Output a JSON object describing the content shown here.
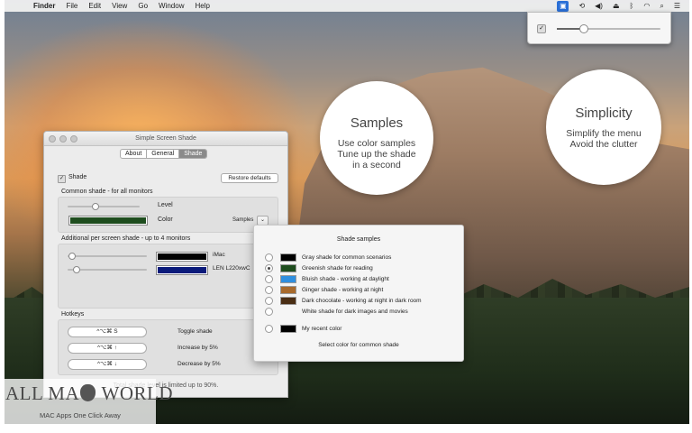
{
  "menubar": {
    "apple": "",
    "items": [
      "Finder",
      "File",
      "Edit",
      "View",
      "Go",
      "Window",
      "Help"
    ],
    "status_icons": [
      "shade-app-icon",
      "time-machine-icon",
      "volume-icon",
      "eject-icon",
      "bluetooth-icon",
      "wifi-icon",
      "spotlight-icon",
      "notification-list-icon"
    ]
  },
  "menu_panel": {
    "checkbox_checked": "✓",
    "level": 0.25
  },
  "bubbles": {
    "samples": {
      "title": "Samples",
      "line1": "Use color samples",
      "line2": "Tune up the shade",
      "line3": "in a second"
    },
    "simplicity": {
      "title": "Simplicity",
      "line1": "Simplify the menu",
      "line2": "Avoid the clutter"
    }
  },
  "window": {
    "title": "Simple Screen Shade",
    "tabs": [
      "About",
      "General",
      "Shade"
    ],
    "active_tab": "Shade",
    "shade_label": "Shade",
    "restore_button": "Restore defaults",
    "common_header": "Common shade - for all monitors",
    "level_label": "Level",
    "color_label": "Color",
    "samples_label": "Samples",
    "common_level": 0.38,
    "common_color": "#1e4d1e",
    "additional_header": "Additional per screen shade - up to 4 monitors",
    "monitors": [
      {
        "name": "iMac",
        "color": "#000000",
        "level": 0.04
      },
      {
        "name": "LEN L220xwC",
        "color": "#0a1a7a",
        "level": 0.1
      }
    ],
    "hotkeys_header": "Hotkeys",
    "hotkeys": [
      {
        "keys": "^⌥⌘ S",
        "action": "Toggle shade"
      },
      {
        "keys": "^⌥⌘ ↑",
        "action": "Increase by 5%"
      },
      {
        "keys": "^⌥⌘ ↓",
        "action": "Decrease by 5%"
      }
    ],
    "total_note": "Total shade level is limited up to 90%."
  },
  "samples_popup": {
    "title": "Shade samples",
    "items": [
      {
        "label": "Gray shade for common scenarios",
        "color": "#000000",
        "selected": false
      },
      {
        "label": "Greenish shade for reading",
        "color": "#1e4d1e",
        "selected": true
      },
      {
        "label": "Bluish shade - working at daylight",
        "color": "#2f8fdf",
        "selected": false
      },
      {
        "label": "Ginger shade - working at night",
        "color": "#a86a2c",
        "selected": false
      },
      {
        "label": "Dark chocolate - working at night in dark room",
        "color": "#4a2e14",
        "selected": false
      },
      {
        "label": "White shade for dark images and movies",
        "color": "",
        "selected": false
      },
      {
        "label": "My recent color",
        "color": "#000000",
        "selected": false
      }
    ],
    "footer": "Select color for common shade"
  },
  "watermark": {
    "brand_left": "ALL MA",
    "brand_right": " WORLD",
    "sub": "MAC Apps One Click Away"
  }
}
